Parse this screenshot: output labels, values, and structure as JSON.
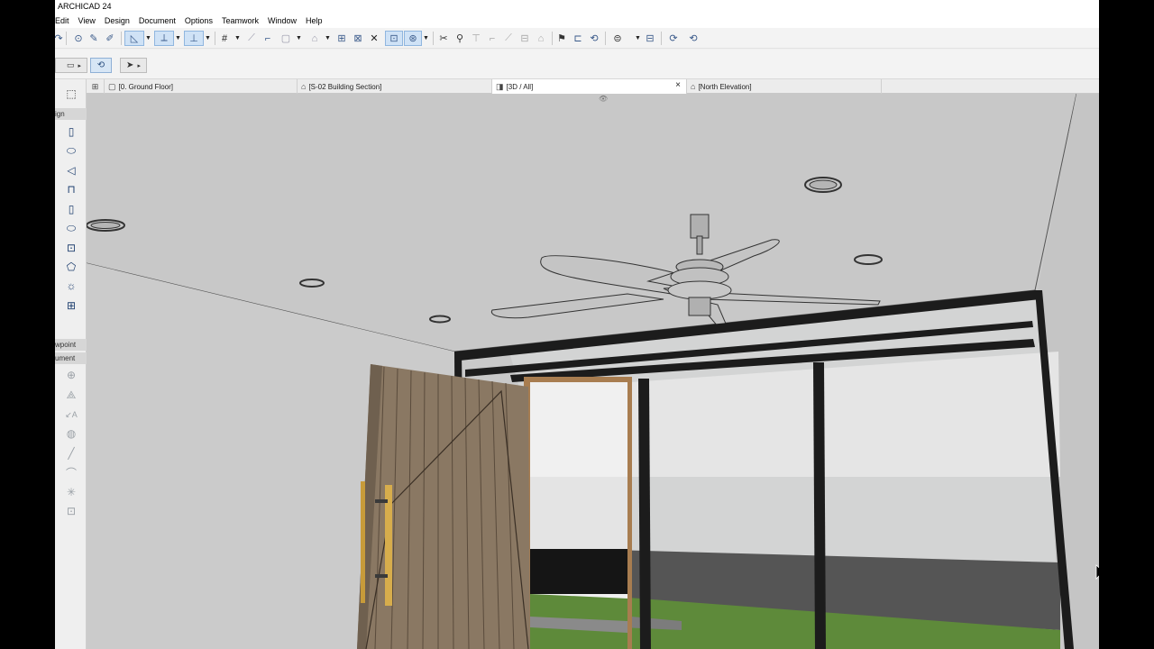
{
  "app": {
    "title": "ARCHICAD 24"
  },
  "menu": [
    "Edit",
    "View",
    "Design",
    "Document",
    "Options",
    "Teamwork",
    "Window",
    "Help"
  ],
  "tabs": [
    {
      "label": "[0. Ground Floor]",
      "icon": "floor-plan-icon"
    },
    {
      "label": "[S-02 Building Section]",
      "icon": "section-icon"
    },
    {
      "label": "[3D / All]",
      "icon": "3d-view-icon",
      "close": "×"
    },
    {
      "label": "[North Elevation]",
      "icon": "elevation-icon"
    }
  ],
  "toolbox": {
    "design_label": "ign",
    "viewpoint_label": "wpoint",
    "document_label": "ument",
    "tools": [
      "arrow-tool",
      "marquee-tool",
      "wall-tool",
      "slab-tool",
      "roof-tool",
      "railing-tool",
      "door-tool",
      "stair-tool",
      "object-tool",
      "shell-tool",
      "lamp-tool",
      "curtain-wall-tool"
    ],
    "doc_tools": [
      "dimension-tool",
      "level-dimension-tool",
      "text-tool",
      "fill-tool",
      "line-tool",
      "arc-tool",
      "hotspot-tool",
      "drawing-tool"
    ]
  },
  "colors": {
    "accent": "#3a5a8a",
    "selected_bg": "#cfe2f6",
    "ceiling": "#c8c8c8",
    "wall": "#cbcbcb",
    "door_wood": "#8a7863",
    "frame": "#1c1c1c",
    "glass": "#d3d4d4",
    "grass": "#5e8a3a"
  }
}
